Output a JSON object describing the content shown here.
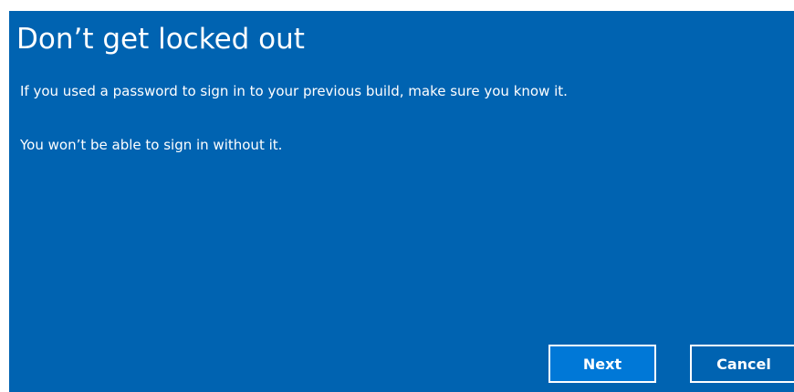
{
  "dialog": {
    "title": "Don’t get locked out",
    "messages": [
      "If you used a password to sign in to your previous build, make sure you know it.",
      "You won’t be able to sign in without it."
    ]
  },
  "buttons": {
    "next_label": "Next",
    "cancel_label": "Cancel"
  },
  "colors": {
    "background": "#0063b1",
    "next_button": "#0078d7",
    "text": "#ffffff"
  }
}
